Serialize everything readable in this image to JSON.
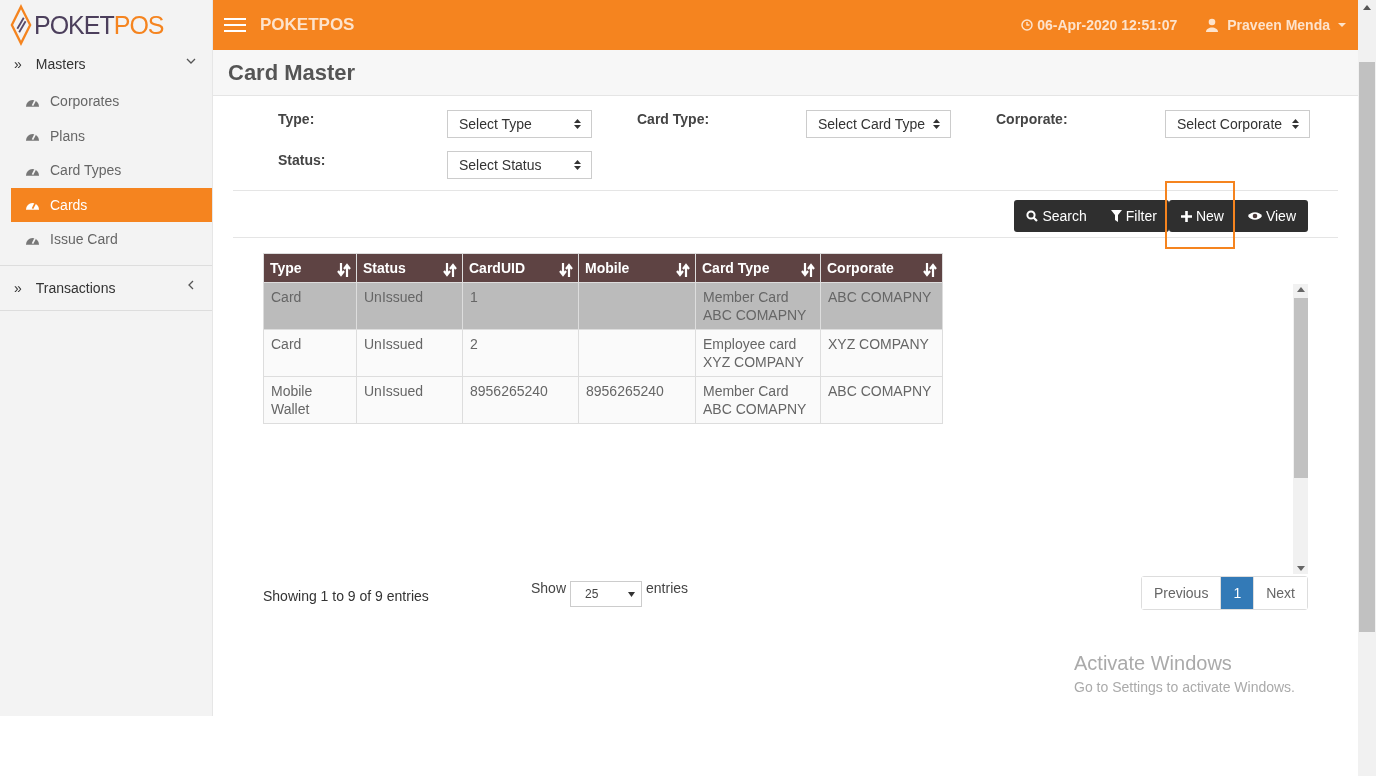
{
  "logo": {
    "text_dark": "POKET",
    "text_light": "POS"
  },
  "header": {
    "title": "POKETPOS",
    "datetime": "06-Apr-2020 12:51:07",
    "user": "Praveen Menda"
  },
  "sidebar": {
    "groups": [
      {
        "icon": "»",
        "label": "Masters",
        "expanded": true,
        "children": [
          {
            "label": "Corporates",
            "selected": false
          },
          {
            "label": "Plans",
            "selected": false
          },
          {
            "label": "Card Types",
            "selected": false
          },
          {
            "label": "Cards",
            "selected": true
          },
          {
            "label": "Issue Card",
            "selected": false
          }
        ]
      },
      {
        "icon": "»",
        "label": "Transactions",
        "expanded": false
      }
    ]
  },
  "page_title": "Card Master",
  "filters": [
    {
      "label": "Type:",
      "value": "Select Type"
    },
    {
      "label": "Card Type:",
      "value": "Select Card Type"
    },
    {
      "label": "Corporate:",
      "value": "Select Corporate"
    },
    {
      "label": "Status:",
      "value": "Select Status"
    }
  ],
  "toolbar": [
    {
      "kind": "search",
      "label": "Search",
      "selected": false
    },
    {
      "kind": "filter",
      "label": "Filter",
      "selected": false
    },
    {
      "kind": "new",
      "label": "New",
      "selected": true
    },
    {
      "kind": "view",
      "label": "View",
      "selected": false
    }
  ],
  "table": {
    "columns": [
      "Type",
      "Status",
      "CardUID",
      "Mobile",
      "Card Type",
      "Corporate"
    ],
    "rows": [
      {
        "selected": true,
        "cells": [
          "Card",
          "UnIssued",
          "1",
          "",
          "Member Card ABC COMAPNY",
          "ABC COMAPNY"
        ]
      },
      {
        "selected": false,
        "cells": [
          "Card",
          "UnIssued",
          "2",
          "",
          "Employee card XYZ COMPANY",
          "XYZ COMPANY"
        ]
      },
      {
        "selected": false,
        "cells": [
          "Mobile Wallet",
          "UnIssued",
          "8956265240",
          "8956265240",
          "Member Card ABC COMAPNY",
          "ABC COMAPNY"
        ]
      }
    ]
  },
  "info": "Showing 1 to 9 of 9 entries",
  "length": {
    "before": "Show",
    "value": "25",
    "after": "entries"
  },
  "pagination": [
    {
      "label": "Previous",
      "selected": false
    },
    {
      "label": "1",
      "selected": true
    },
    {
      "label": "Next",
      "selected": false
    }
  ],
  "os_notice": {
    "title": "Activate Windows",
    "text": "Go to Settings to activate Windows."
  }
}
